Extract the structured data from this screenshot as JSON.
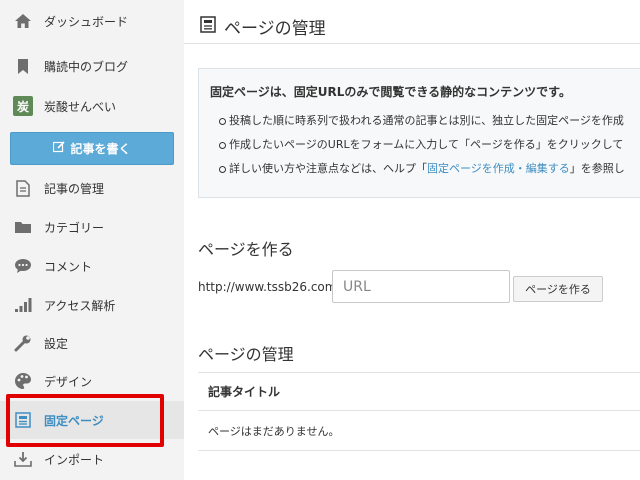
{
  "sidebar": {
    "items": [
      {
        "label": "ダッシュボード",
        "icon": "home-icon"
      },
      {
        "label": "購読中のブログ",
        "icon": "bookmark-icon"
      },
      {
        "label": "炭酸せんべい",
        "icon": "blog-avatar-icon"
      },
      {
        "label": "記事の管理",
        "icon": "document-icon"
      },
      {
        "label": "カテゴリー",
        "icon": "folder-icon"
      },
      {
        "label": "コメント",
        "icon": "comment-icon"
      },
      {
        "label": "アクセス解析",
        "icon": "bar-chart-icon"
      },
      {
        "label": "設定",
        "icon": "wrench-icon"
      },
      {
        "label": "デザイン",
        "icon": "palette-icon"
      },
      {
        "label": "固定ページ",
        "icon": "page-icon"
      },
      {
        "label": "インポート",
        "icon": "import-icon"
      }
    ],
    "active_item": "固定ページ",
    "write_button": "記事を書く",
    "avatar_glyph": "炭"
  },
  "header": {
    "title": "ページの管理"
  },
  "notice": {
    "lead": "固定ページは、固定URLのみで閲覧できる静的なコンテンツです。",
    "bullet1": "投稿した順に時系列で扱われる通常の記事とは別に、独立した固定ページを作成",
    "bullet2": "作成したいページのURLをフォームに入力して「ページを作る」をクリックして",
    "bullet3_pre": "詳しい使い方や注意点などは、ヘルプ「",
    "bullet3_link": "固定ページを作成・編集する",
    "bullet3_post": "」を参照し"
  },
  "create": {
    "title": "ページを作る",
    "url_prefix": "http://www.tssb26.com/",
    "input_placeholder": "URL",
    "button": "ページを作る"
  },
  "manage": {
    "title": "ページの管理",
    "column_header": "記事タイトル",
    "empty_message": "ページはまだありません。"
  },
  "colors": {
    "accent": "#3e8ec2",
    "button_blue": "#5baad7",
    "highlight_red": "#e10000",
    "sidebar_bg": "#f3f3f3"
  }
}
